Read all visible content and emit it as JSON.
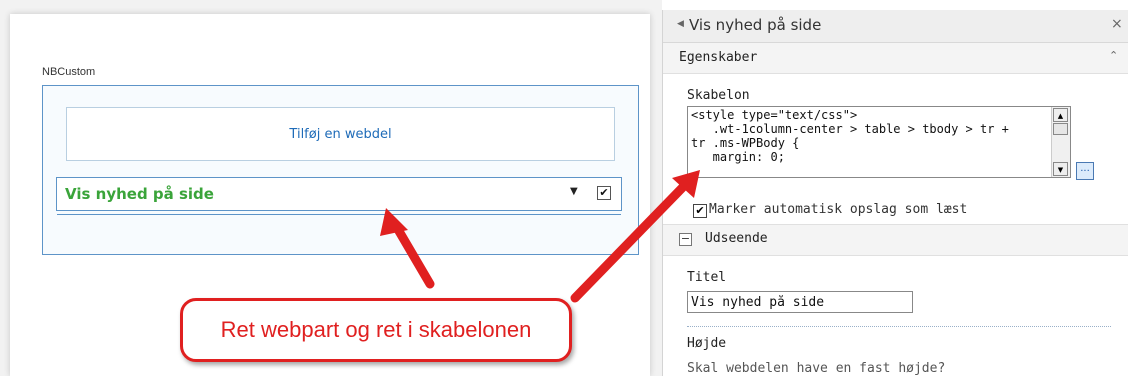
{
  "page": {
    "zone_label": "NBCustom",
    "add_webpart": "Tilføj en webdel",
    "webpart_title": "Vis nyhed på side",
    "webpart_menu_icon": "▼",
    "webpart_check_icon": "✔"
  },
  "tool_pane": {
    "title": "Vis nyhed på side",
    "close_icon": "×",
    "collapse_icon": "◀",
    "properties": {
      "title": "Egenskaber",
      "toggle_icon": "⌃",
      "template_label": "Skabelon",
      "template_text": "<style type=\"text/css\">\n   .wt-1column-center > table > tbody > tr +\ntr .ms-WPBody {\n   margin: 0;",
      "builder_button": "...",
      "auto_check_label": "Marker automatisk opslag som læst",
      "auto_check_checked": true
    },
    "appearance": {
      "toggle_icon": "−",
      "title": "Udseende",
      "title_label": "Titel",
      "title_value": "Vis nyhed på side",
      "height_label": "Højde",
      "height_question": "Skal webdelen have en fast højde?"
    }
  },
  "annotation": {
    "text": "Ret webpart og ret i skabelonen",
    "color": "#e02020"
  },
  "colors": {
    "webpart_title": "#3aa43a",
    "link": "#1e6bb8",
    "zone_border": "#5d94c8"
  }
}
